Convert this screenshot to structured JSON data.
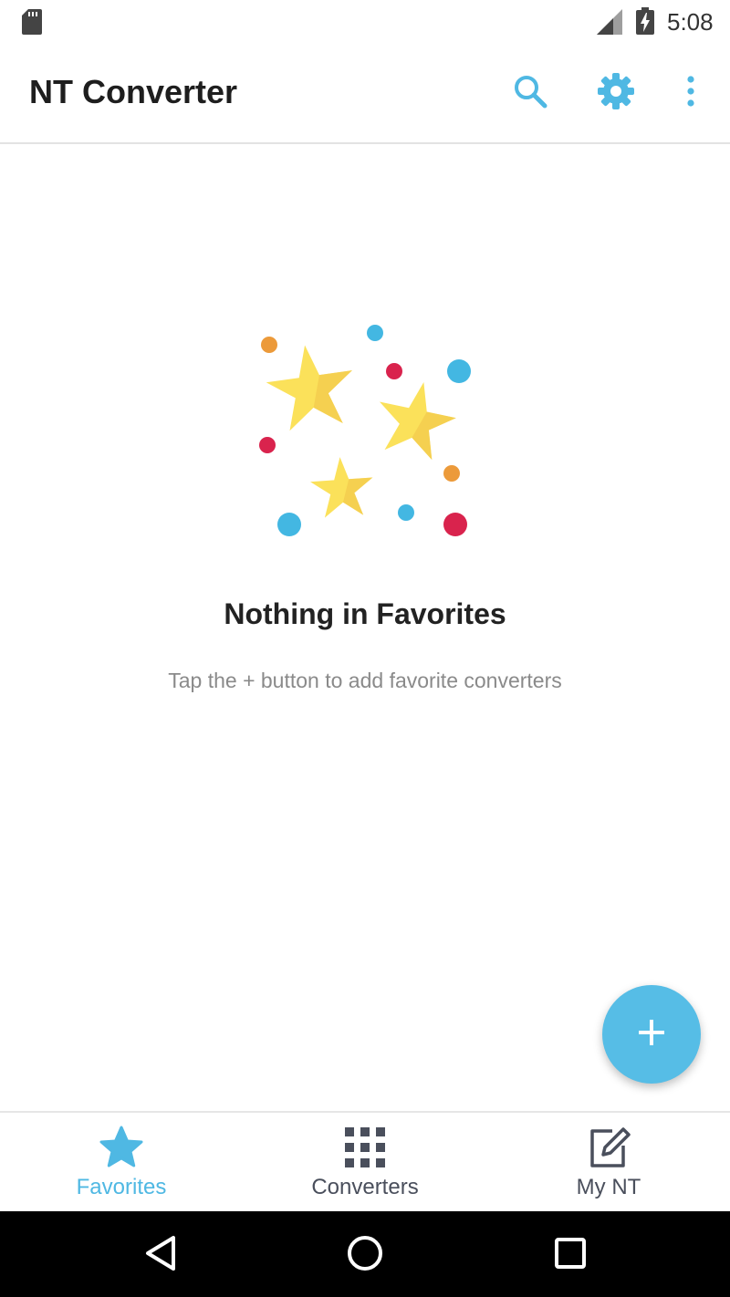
{
  "status_bar": {
    "time": "5:08",
    "icons": [
      "sd-card-icon",
      "cellular-signal-icon",
      "battery-charging-icon"
    ]
  },
  "app_bar": {
    "title": "NT Converter",
    "actions": [
      "search-icon",
      "gear-icon",
      "more-vert-icon"
    ]
  },
  "empty_state": {
    "illustration": "stars-illustration",
    "title": "Nothing in Favorites",
    "subtitle": "Tap the + button to add favorite converters"
  },
  "fab": {
    "icon": "plus-icon"
  },
  "bottom_nav": {
    "items": [
      {
        "label": "Favorites",
        "icon": "star-icon",
        "active": true
      },
      {
        "label": "Converters",
        "icon": "grid-icon",
        "active": false
      },
      {
        "label": "My NT",
        "icon": "edit-note-icon",
        "active": false
      }
    ]
  },
  "system_nav": [
    "back-icon",
    "home-icon",
    "recents-icon"
  ],
  "colors": {
    "accent": "#4fb8e3",
    "nav_inactive": "#4a4f5c",
    "title_text": "#1e1e1e",
    "subtitle_text": "#8a8a8a",
    "star_yellow": "#fbe15a",
    "dot_red": "#d9234d",
    "dot_orange": "#ec9a3a",
    "dot_blue": "#43b7e2"
  }
}
